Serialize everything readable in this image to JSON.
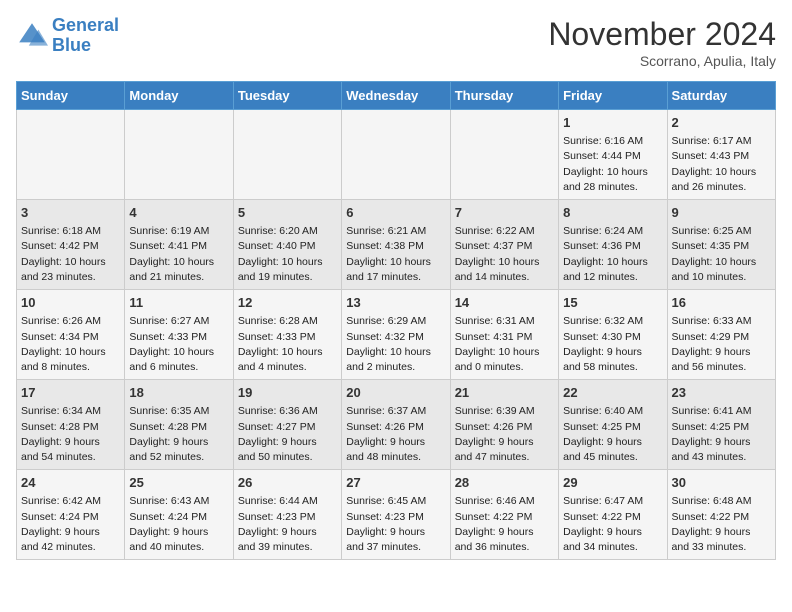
{
  "header": {
    "logo_line1": "General",
    "logo_line2": "Blue",
    "month": "November 2024",
    "location": "Scorrano, Apulia, Italy"
  },
  "weekdays": [
    "Sunday",
    "Monday",
    "Tuesday",
    "Wednesday",
    "Thursday",
    "Friday",
    "Saturday"
  ],
  "weeks": [
    [
      {
        "day": "",
        "info": ""
      },
      {
        "day": "",
        "info": ""
      },
      {
        "day": "",
        "info": ""
      },
      {
        "day": "",
        "info": ""
      },
      {
        "day": "",
        "info": ""
      },
      {
        "day": "1",
        "info": "Sunrise: 6:16 AM\nSunset: 4:44 PM\nDaylight: 10 hours\nand 28 minutes."
      },
      {
        "day": "2",
        "info": "Sunrise: 6:17 AM\nSunset: 4:43 PM\nDaylight: 10 hours\nand 26 minutes."
      }
    ],
    [
      {
        "day": "3",
        "info": "Sunrise: 6:18 AM\nSunset: 4:42 PM\nDaylight: 10 hours\nand 23 minutes."
      },
      {
        "day": "4",
        "info": "Sunrise: 6:19 AM\nSunset: 4:41 PM\nDaylight: 10 hours\nand 21 minutes."
      },
      {
        "day": "5",
        "info": "Sunrise: 6:20 AM\nSunset: 4:40 PM\nDaylight: 10 hours\nand 19 minutes."
      },
      {
        "day": "6",
        "info": "Sunrise: 6:21 AM\nSunset: 4:38 PM\nDaylight: 10 hours\nand 17 minutes."
      },
      {
        "day": "7",
        "info": "Sunrise: 6:22 AM\nSunset: 4:37 PM\nDaylight: 10 hours\nand 14 minutes."
      },
      {
        "day": "8",
        "info": "Sunrise: 6:24 AM\nSunset: 4:36 PM\nDaylight: 10 hours\nand 12 minutes."
      },
      {
        "day": "9",
        "info": "Sunrise: 6:25 AM\nSunset: 4:35 PM\nDaylight: 10 hours\nand 10 minutes."
      }
    ],
    [
      {
        "day": "10",
        "info": "Sunrise: 6:26 AM\nSunset: 4:34 PM\nDaylight: 10 hours\nand 8 minutes."
      },
      {
        "day": "11",
        "info": "Sunrise: 6:27 AM\nSunset: 4:33 PM\nDaylight: 10 hours\nand 6 minutes."
      },
      {
        "day": "12",
        "info": "Sunrise: 6:28 AM\nSunset: 4:33 PM\nDaylight: 10 hours\nand 4 minutes."
      },
      {
        "day": "13",
        "info": "Sunrise: 6:29 AM\nSunset: 4:32 PM\nDaylight: 10 hours\nand 2 minutes."
      },
      {
        "day": "14",
        "info": "Sunrise: 6:31 AM\nSunset: 4:31 PM\nDaylight: 10 hours\nand 0 minutes."
      },
      {
        "day": "15",
        "info": "Sunrise: 6:32 AM\nSunset: 4:30 PM\nDaylight: 9 hours\nand 58 minutes."
      },
      {
        "day": "16",
        "info": "Sunrise: 6:33 AM\nSunset: 4:29 PM\nDaylight: 9 hours\nand 56 minutes."
      }
    ],
    [
      {
        "day": "17",
        "info": "Sunrise: 6:34 AM\nSunset: 4:28 PM\nDaylight: 9 hours\nand 54 minutes."
      },
      {
        "day": "18",
        "info": "Sunrise: 6:35 AM\nSunset: 4:28 PM\nDaylight: 9 hours\nand 52 minutes."
      },
      {
        "day": "19",
        "info": "Sunrise: 6:36 AM\nSunset: 4:27 PM\nDaylight: 9 hours\nand 50 minutes."
      },
      {
        "day": "20",
        "info": "Sunrise: 6:37 AM\nSunset: 4:26 PM\nDaylight: 9 hours\nand 48 minutes."
      },
      {
        "day": "21",
        "info": "Sunrise: 6:39 AM\nSunset: 4:26 PM\nDaylight: 9 hours\nand 47 minutes."
      },
      {
        "day": "22",
        "info": "Sunrise: 6:40 AM\nSunset: 4:25 PM\nDaylight: 9 hours\nand 45 minutes."
      },
      {
        "day": "23",
        "info": "Sunrise: 6:41 AM\nSunset: 4:25 PM\nDaylight: 9 hours\nand 43 minutes."
      }
    ],
    [
      {
        "day": "24",
        "info": "Sunrise: 6:42 AM\nSunset: 4:24 PM\nDaylight: 9 hours\nand 42 minutes."
      },
      {
        "day": "25",
        "info": "Sunrise: 6:43 AM\nSunset: 4:24 PM\nDaylight: 9 hours\nand 40 minutes."
      },
      {
        "day": "26",
        "info": "Sunrise: 6:44 AM\nSunset: 4:23 PM\nDaylight: 9 hours\nand 39 minutes."
      },
      {
        "day": "27",
        "info": "Sunrise: 6:45 AM\nSunset: 4:23 PM\nDaylight: 9 hours\nand 37 minutes."
      },
      {
        "day": "28",
        "info": "Sunrise: 6:46 AM\nSunset: 4:22 PM\nDaylight: 9 hours\nand 36 minutes."
      },
      {
        "day": "29",
        "info": "Sunrise: 6:47 AM\nSunset: 4:22 PM\nDaylight: 9 hours\nand 34 minutes."
      },
      {
        "day": "30",
        "info": "Sunrise: 6:48 AM\nSunset: 4:22 PM\nDaylight: 9 hours\nand 33 minutes."
      }
    ]
  ]
}
